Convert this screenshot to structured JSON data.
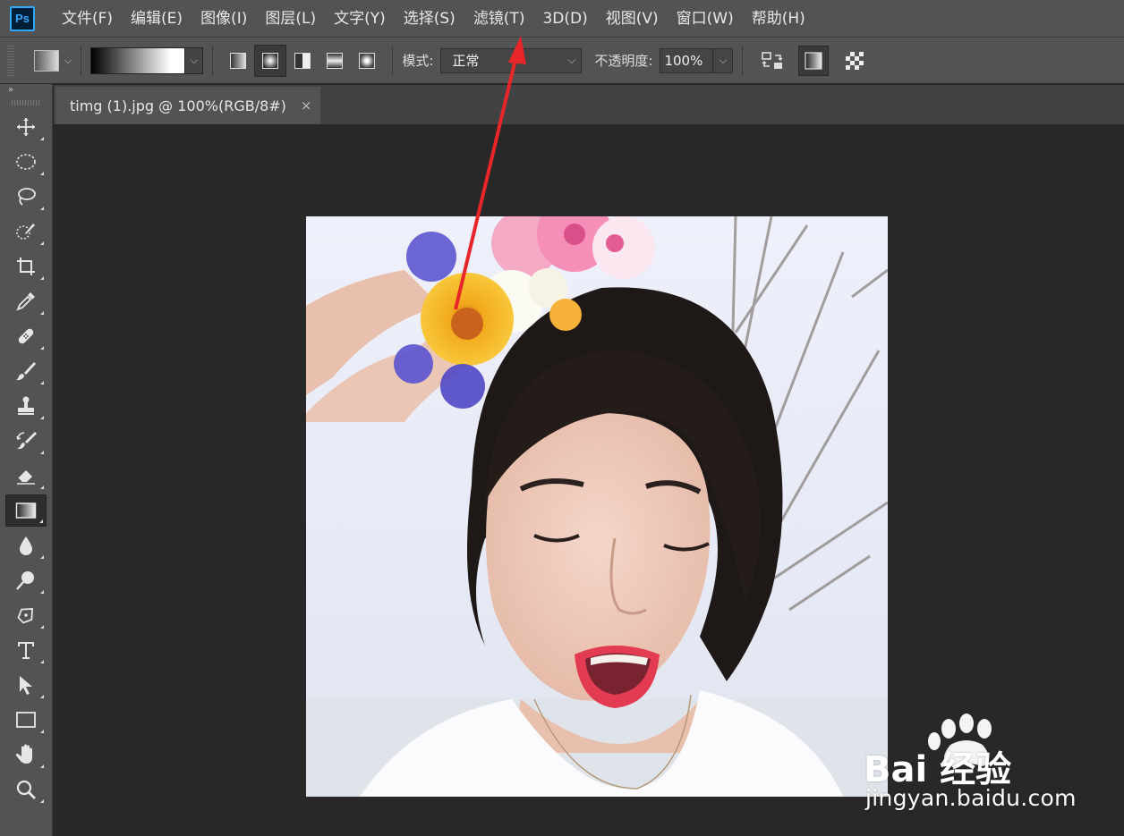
{
  "app": {
    "logo": "Ps"
  },
  "menu": [
    {
      "label": "文件(F)"
    },
    {
      "label": "编辑(E)"
    },
    {
      "label": "图像(I)"
    },
    {
      "label": "图层(L)"
    },
    {
      "label": "文字(Y)"
    },
    {
      "label": "选择(S)"
    },
    {
      "label": "滤镜(T)"
    },
    {
      "label": "3D(D)"
    },
    {
      "label": "视图(V)"
    },
    {
      "label": "窗口(W)"
    },
    {
      "label": "帮助(H)"
    }
  ],
  "options": {
    "mode_label": "模式:",
    "mode_value": "正常",
    "opacity_label": "不透明度:",
    "opacity_value": "100%",
    "gradient_types": [
      "linear-gradient",
      "radial-gradient",
      "angle-gradient",
      "reflected-gradient",
      "diamond-gradient"
    ],
    "selected_gradient_type": 1
  },
  "toolbar": {
    "collapse": "»",
    "tools": [
      {
        "name": "move-tool",
        "icon": "move-icon"
      },
      {
        "name": "marquee-tool",
        "icon": "ellipse-marquee-icon"
      },
      {
        "name": "lasso-tool",
        "icon": "lasso-icon"
      },
      {
        "name": "quick-selection-tool",
        "icon": "quick-selection-icon"
      },
      {
        "name": "crop-tool",
        "icon": "crop-icon"
      },
      {
        "name": "eyedropper-tool",
        "icon": "eyedropper-icon"
      },
      {
        "name": "healing-brush-tool",
        "icon": "bandage-icon"
      },
      {
        "name": "brush-tool",
        "icon": "brush-icon"
      },
      {
        "name": "clone-stamp-tool",
        "icon": "stamp-icon"
      },
      {
        "name": "history-brush-tool",
        "icon": "history-brush-icon"
      },
      {
        "name": "eraser-tool",
        "icon": "eraser-icon"
      },
      {
        "name": "gradient-tool",
        "icon": "gradient-icon",
        "selected": true
      },
      {
        "name": "blur-tool",
        "icon": "drop-icon"
      },
      {
        "name": "dodge-tool",
        "icon": "dodge-icon"
      },
      {
        "name": "pen-tool",
        "icon": "pen-icon"
      },
      {
        "name": "type-tool",
        "icon": "type-icon"
      },
      {
        "name": "path-selection-tool",
        "icon": "arrow-cursor-icon"
      },
      {
        "name": "rectangle-tool",
        "icon": "rectangle-icon"
      },
      {
        "name": "hand-tool",
        "icon": "hand-icon"
      },
      {
        "name": "zoom-tool",
        "icon": "magnifier-icon"
      }
    ]
  },
  "document": {
    "tab_title": "timg (1).jpg @ 100%(RGB/8#)",
    "close": "×"
  },
  "watermark": {
    "brand_text": "Bai 经验",
    "url": "jingyan.baidu.com"
  },
  "colors": {
    "menubar": "#535353",
    "canvas_bg": "#282828",
    "ps_accent": "#31a8ff",
    "arrow": "#e8262a"
  }
}
